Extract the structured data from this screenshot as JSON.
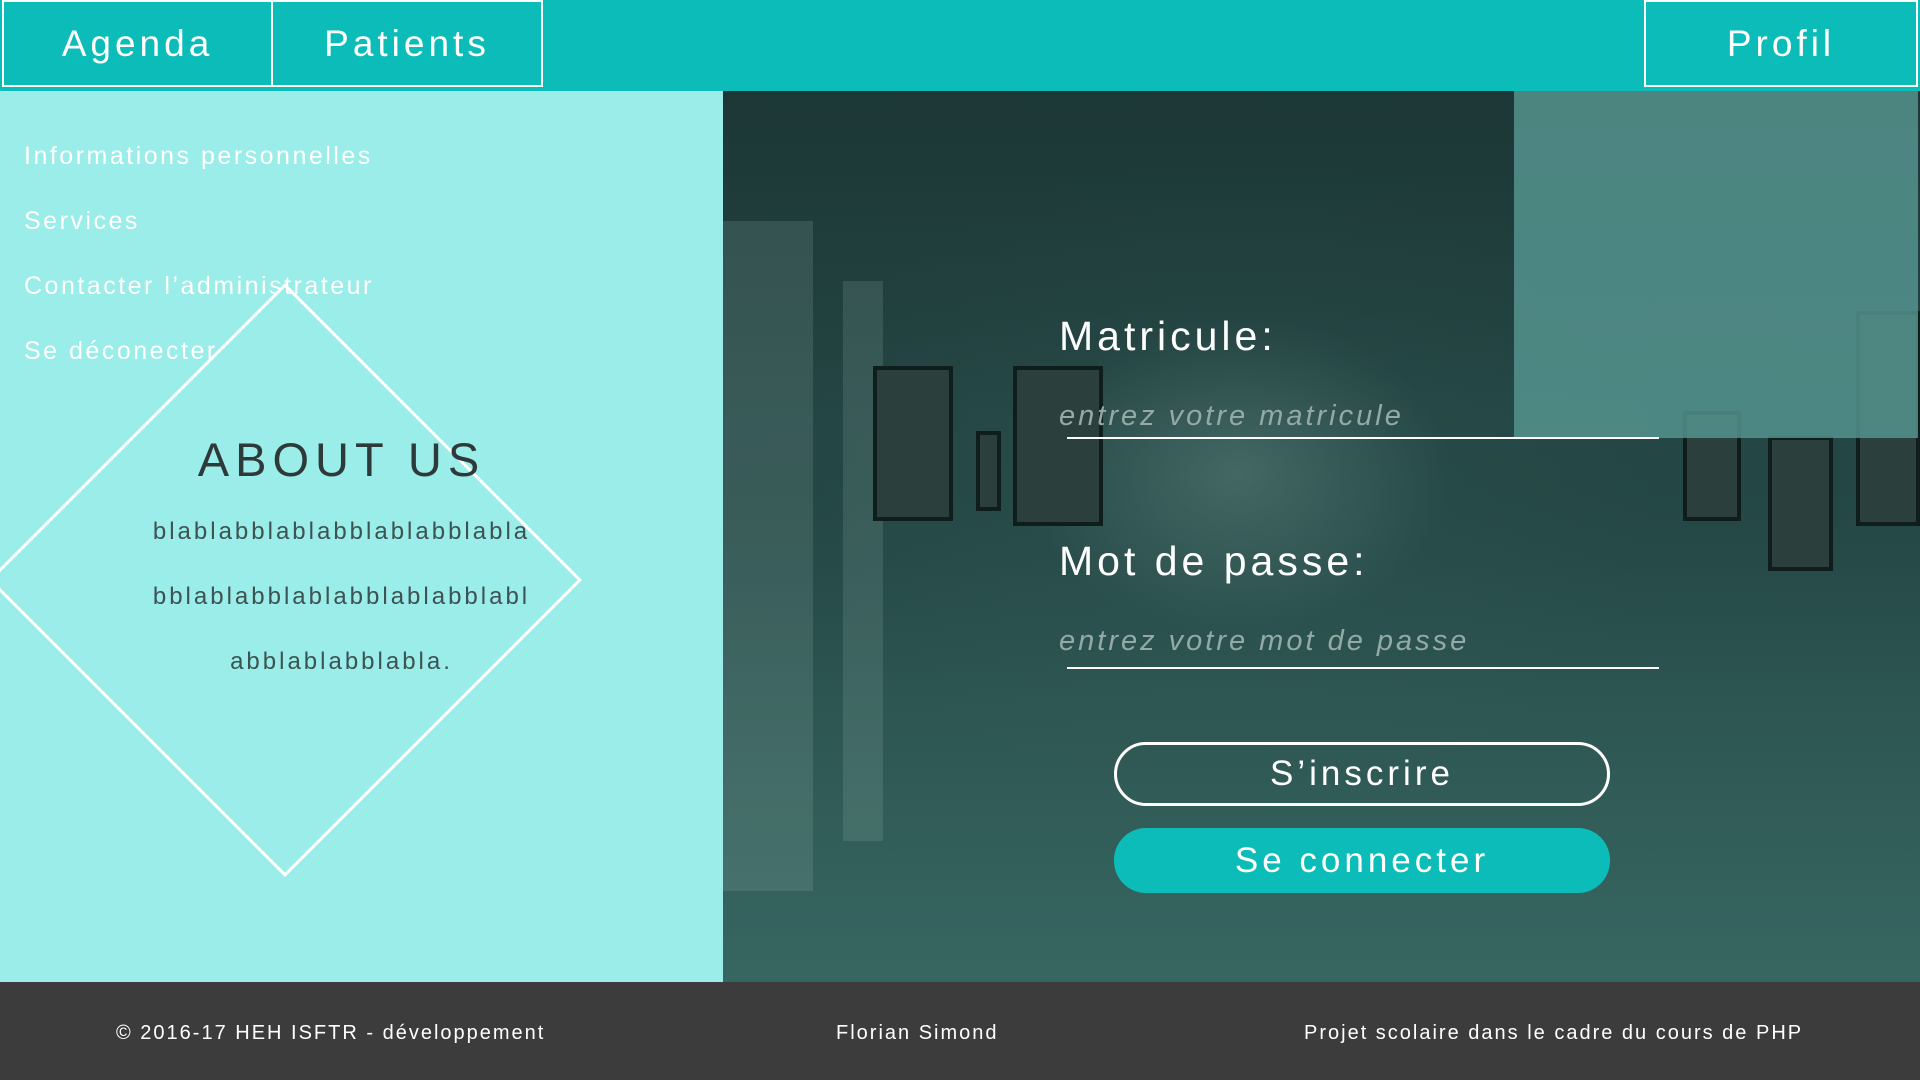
{
  "nav": {
    "agenda": "Agenda",
    "patients": "Patients",
    "profil": "Profil"
  },
  "profile_menu": {
    "items": [
      "Informations personnelles",
      "Services",
      "Contacter l’administrateur",
      "Se déconecter"
    ]
  },
  "about": {
    "title": "ABOUT US",
    "lines": [
      "blablabblablabblablabblabla",
      "bblablabblablabblablabblabl",
      "abblablabblabla."
    ]
  },
  "login": {
    "matricule_label": "Matricule:",
    "matricule_placeholder": "entrez votre matricule",
    "matricule_value": "",
    "password_label": "Mot de passe:",
    "password_placeholder": "entrez votre mot de passe",
    "password_value": "",
    "register_label": "S’inscrire",
    "login_label": "Se connecter"
  },
  "footer": {
    "copyright": "© 2016-17 HEH ISFTR - développement",
    "author": "Florian Simond",
    "project": "Projet scolaire dans le cadre du cours de PHP"
  },
  "colors": {
    "accent": "#0bbcb9",
    "about_bg": "#9aede8",
    "footer_bg": "#3c3c3c",
    "dropdown_bg": "#579691"
  }
}
